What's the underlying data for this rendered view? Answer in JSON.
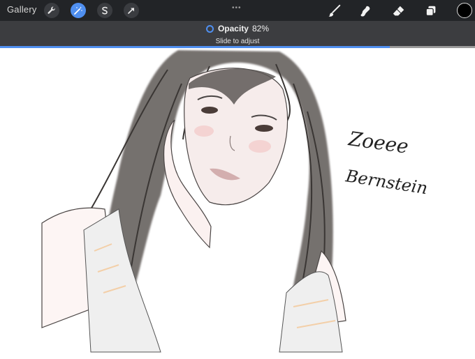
{
  "toolbar": {
    "gallery_label": "Gallery",
    "more_dots": "•••",
    "left_tools": [
      {
        "name": "wrench-icon"
      },
      {
        "name": "magic-wand-icon",
        "active": true
      },
      {
        "name": "selection-s-icon"
      },
      {
        "name": "transform-arrow-icon"
      }
    ],
    "right_tools": [
      {
        "name": "brush-icon"
      },
      {
        "name": "smudge-icon"
      },
      {
        "name": "eraser-icon"
      },
      {
        "name": "layers-icon"
      }
    ],
    "current_color": "#000000"
  },
  "opacity_panel": {
    "label": "Opacity",
    "value_text": "82%",
    "hint": "Slide to adjust",
    "level": 0.82,
    "accent": "#4f8ff0"
  },
  "canvas": {
    "signature_line1": "Zoeee",
    "signature_line2": "Bernstein"
  }
}
